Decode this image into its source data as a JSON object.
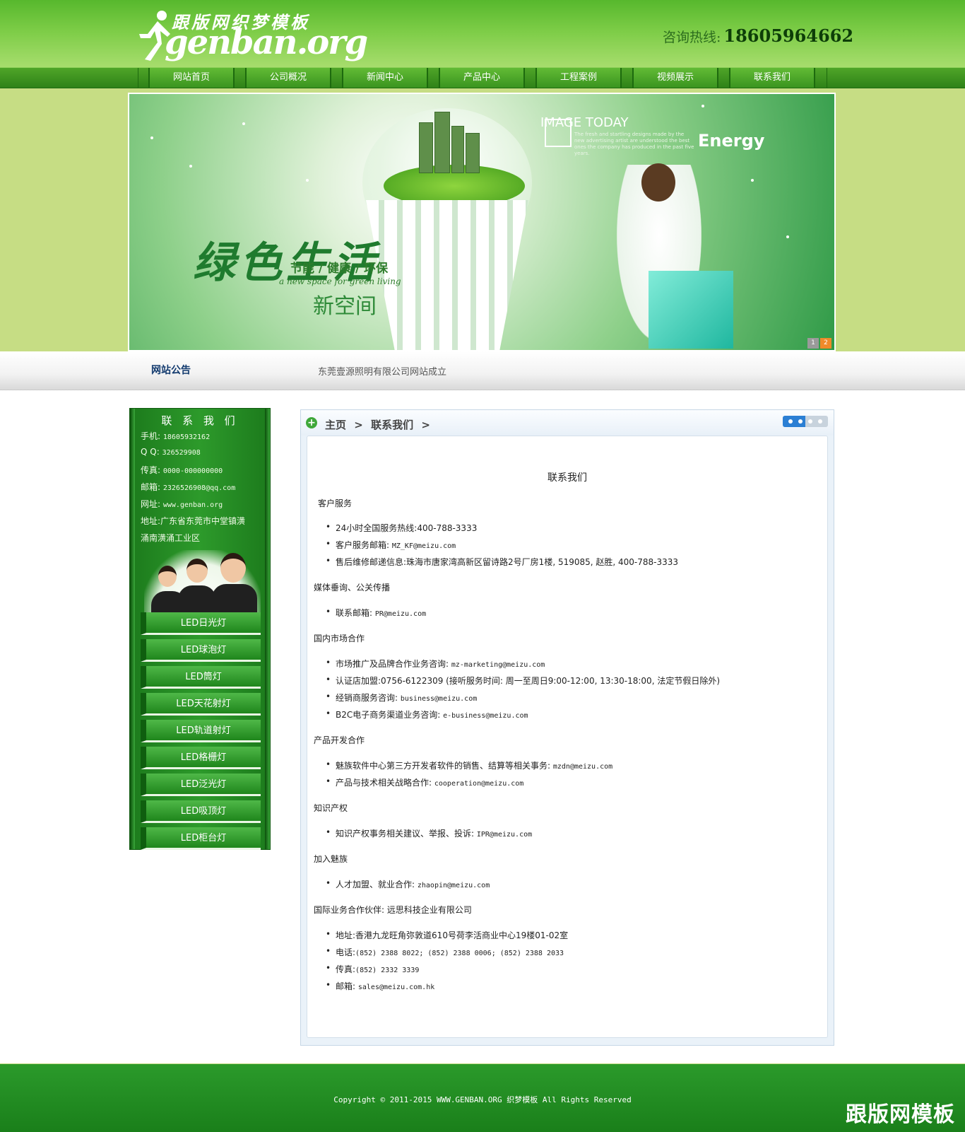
{
  "header": {
    "logo_cn": "跟版网织梦模板",
    "logo_en": "genban.org",
    "hotline_label": "咨询热线:",
    "hotline_number": "18605964662"
  },
  "nav": {
    "items": [
      "网站首页",
      "公司概况",
      "新闻中心",
      "产品中心",
      "工程案例",
      "视频展示",
      "联系我们"
    ]
  },
  "banner": {
    "title_big": "绿色生活",
    "title_sub": "新空间",
    "tagline": "节能 / 健康 / 环保",
    "tagline_en": "a new space for green living",
    "image_today": "IMAGE TODAY",
    "image_today_small": "The fresh and startling designs made by the new advertising artist are understood the best ones the company has produced in the past five years.",
    "energy": "Energy",
    "pages": [
      "1",
      "2"
    ]
  },
  "notice": {
    "label": "网站公告",
    "text": "东莞壹源照明有限公司网站成立"
  },
  "sidebar": {
    "title": "联 系 我 们",
    "lines": [
      {
        "label": "手机:",
        "value": "18605932162"
      },
      {
        "label": "Q Q:",
        "value": "326529908"
      },
      {
        "label": "传真:",
        "value": "0000-000000000"
      },
      {
        "label": "邮箱:",
        "value": "2326526908@qq.com"
      },
      {
        "label": "网址:",
        "value": "www.genban.org"
      },
      {
        "label": "地址:",
        "value": "广东省东莞市中堂镇潢"
      },
      {
        "label": "",
        "value": "涌南潢涌工业区"
      }
    ],
    "menu": [
      "LED日光灯",
      "LED球泡灯",
      "LED筒灯",
      "LED天花射灯",
      "LED轨道射灯",
      "LED格栅灯",
      "LED泛光灯",
      "LED吸顶灯",
      "LED柜台灯"
    ]
  },
  "content": {
    "crumbs": [
      "主页",
      ">",
      "联系我们",
      ">"
    ],
    "heading": "联系我们",
    "sections": [
      {
        "title": "客户服务",
        "items": [
          {
            "label": "24小时全国服务热线:",
            "value": "400-788-3333"
          },
          {
            "label": "客户服务邮箱:",
            "value": "MZ_KF@meizu.com"
          },
          {
            "label": "售后维修邮递信息:",
            "value": "珠海市唐家湾高新区留诗路2号厂房1楼, 519085, 赵胜, 400-788-3333"
          }
        ]
      },
      {
        "title": "媒体垂询、公关传播",
        "items": [
          {
            "label": "联系邮箱:",
            "value": "PR@meizu.com"
          }
        ]
      },
      {
        "title": "国内市场合作",
        "items": [
          {
            "label": "市场推广及品牌合作业务咨询:",
            "value": "mz-marketing@meizu.com"
          },
          {
            "label": "认证店加盟:",
            "value": "0756-6122309 (接听服务时间: 周一至周日9:00-12:00, 13:30-18:00, 法定节假日除外)"
          },
          {
            "label": "经销商服务咨询:",
            "value": "business@meizu.com"
          },
          {
            "label": "B2C电子商务渠道业务咨询:",
            "value": "e-business@meizu.com"
          }
        ]
      },
      {
        "title": "产品开发合作",
        "items": [
          {
            "label": "魅族软件中心第三方开发者软件的销售、结算等相关事务:",
            "value": "mzdn@meizu.com"
          },
          {
            "label": "产品与技术相关战略合作:",
            "value": "cooperation@meizu.com"
          }
        ]
      },
      {
        "title": "知识产权",
        "items": [
          {
            "label": "知识产权事务相关建议、举报、投诉:",
            "value": "IPR@meizu.com"
          }
        ]
      },
      {
        "title": "加入魅族",
        "items": [
          {
            "label": "人才加盟、就业合作:",
            "value": "zhaopin@meizu.com"
          }
        ]
      },
      {
        "title": "国际业务合作伙伴: 远思科技企业有限公司",
        "items": [
          {
            "label": "地址:",
            "value": "香港九龙旺角弥敦道610号荷李活商业中心19楼01-02室"
          },
          {
            "label": "电话:",
            "value": "(852) 2388 8022; (852) 2388 0006; (852) 2388 2033"
          },
          {
            "label": "传真:",
            "value": "(852) 2332 3339"
          },
          {
            "label": "邮箱:",
            "value": "sales@meizu.com.hk"
          }
        ]
      }
    ]
  },
  "footer": {
    "copyright": "Copyright © 2011-2015 WWW.GENBAN.ORG 织梦模板 All Rights Reserved",
    "watermark": "跟版网模板"
  }
}
